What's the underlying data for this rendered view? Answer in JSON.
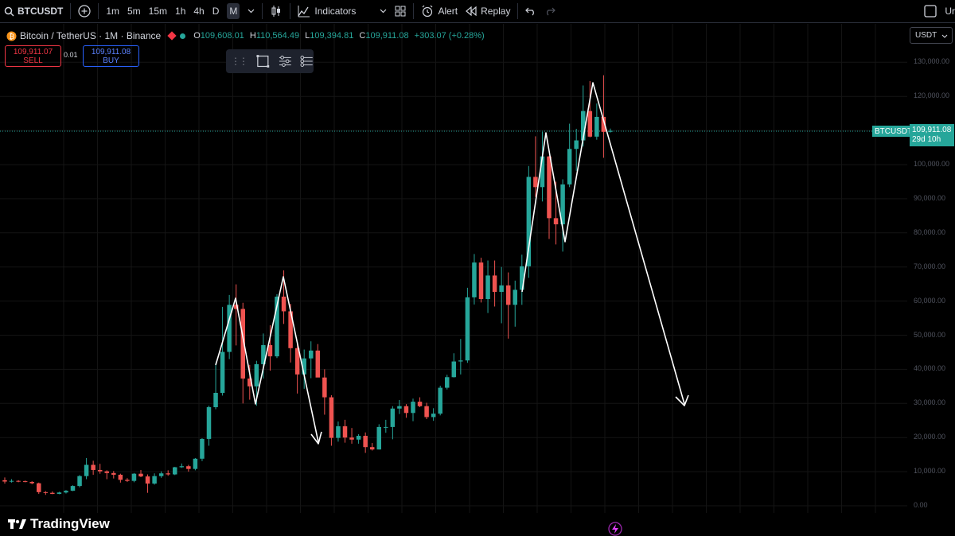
{
  "toolbar": {
    "symbol": "BTCUSDT",
    "intervals": [
      "1m",
      "5m",
      "15m",
      "1h",
      "4h",
      "D",
      "M"
    ],
    "selected_interval": "M",
    "indicators_label": "Indicators",
    "alert_label": "Alert",
    "replay_label": "Replay",
    "right_cut_label": "Ur"
  },
  "legend": {
    "title": "Bitcoin / TetherUS · 1M · Binance",
    "o_label": "O",
    "o": "109,608.01",
    "h_label": "H",
    "h": "110,564.49",
    "l_label": "L",
    "l": "109,394.81",
    "c_label": "C",
    "c": "109,911.08",
    "change": "+303.07 (+0.28%)"
  },
  "trade": {
    "sell_price": "109,911.07",
    "sell_label": "SELL",
    "spread": "0.01",
    "buy_price": "109,911.08",
    "buy_label": "BUY"
  },
  "currency": "USDT",
  "price_axis": {
    "labels": [
      "130,000.00",
      "120,000.00",
      "110,000.00",
      "100,000.00",
      "90,000.00",
      "80,000.00",
      "70,000.00",
      "60,000.00",
      "50,000.00",
      "40,000.00",
      "30,000.00",
      "20,000.00",
      "10,000.00",
      "0.00"
    ],
    "symbol_tag": "BTCUSDT",
    "last_price": "109,911.08",
    "countdown": "29d 10h"
  },
  "branding": {
    "name": "TradingView"
  },
  "colors": {
    "up": "#26a69a",
    "down": "#ef5350",
    "background": "#000000",
    "annotation": "#ffffff"
  },
  "chart_data": {
    "type": "candlestick",
    "interval": "1M",
    "ohlc": [
      [
        7500,
        8300,
        6500,
        7100
      ],
      [
        7100,
        7800,
        6800,
        7300
      ],
      [
        7300,
        7500,
        6900,
        7200
      ],
      [
        7200,
        7400,
        6900,
        7000
      ],
      [
        7000,
        7200,
        6300,
        6600
      ],
      [
        6600,
        6800,
        3500,
        4000
      ],
      [
        4000,
        4300,
        3200,
        3800
      ],
      [
        3800,
        4200,
        3400,
        3500
      ],
      [
        3500,
        4100,
        3400,
        3900
      ],
      [
        3900,
        4600,
        3600,
        4400
      ],
      [
        4400,
        6000,
        4300,
        5800
      ],
      [
        5800,
        9000,
        5400,
        8700
      ],
      [
        8700,
        14000,
        7800,
        12000
      ],
      [
        12000,
        13200,
        9100,
        10500
      ],
      [
        10500,
        12300,
        9400,
        10100
      ],
      [
        10100,
        10400,
        7800,
        9600
      ],
      [
        9600,
        10200,
        8000,
        9100
      ],
      [
        9100,
        9400,
        6800,
        7600
      ],
      [
        7600,
        8100,
        7000,
        7300
      ],
      [
        7300,
        9600,
        6900,
        9400
      ],
      [
        9400,
        10500,
        8400,
        8600
      ],
      [
        8600,
        9200,
        3800,
        6500
      ],
      [
        6500,
        9500,
        6200,
        8700
      ],
      [
        8700,
        10100,
        8200,
        9500
      ],
      [
        9500,
        10400,
        8800,
        9200
      ],
      [
        9200,
        11400,
        9000,
        11300
      ],
      [
        11300,
        12400,
        11100,
        11600
      ],
      [
        11600,
        12000,
        10000,
        10800
      ],
      [
        10800,
        14000,
        10400,
        13800
      ],
      [
        13800,
        19800,
        13100,
        19600
      ],
      [
        19600,
        29300,
        17600,
        28900
      ],
      [
        28900,
        41900,
        28300,
        33100
      ],
      [
        33100,
        58300,
        32300,
        45100
      ],
      [
        45100,
        61800,
        43000,
        58900
      ],
      [
        58900,
        64900,
        47000,
        57700
      ],
      [
        57700,
        59500,
        30000,
        37300
      ],
      [
        37300,
        41300,
        31100,
        35000
      ],
      [
        35000,
        42500,
        29300,
        41500
      ],
      [
        41500,
        50500,
        37300,
        47100
      ],
      [
        47100,
        52900,
        39600,
        43800
      ],
      [
        43800,
        62000,
        43300,
        61300
      ],
      [
        61300,
        69000,
        53300,
        57000
      ],
      [
        57000,
        59200,
        42000,
        46200
      ],
      [
        46200,
        48000,
        32900,
        38500
      ],
      [
        38500,
        45800,
        34300,
        43200
      ],
      [
        43200,
        48200,
        37400,
        45500
      ],
      [
        45500,
        47400,
        37700,
        37600
      ],
      [
        37600,
        40000,
        26700,
        31800
      ],
      [
        31800,
        32400,
        17600,
        19900
      ],
      [
        19900,
        24700,
        18800,
        23300
      ],
      [
        23300,
        25200,
        18500,
        20000
      ],
      [
        20000,
        22800,
        18200,
        19400
      ],
      [
        19400,
        21000,
        18200,
        20500
      ],
      [
        20500,
        21500,
        15500,
        17200
      ],
      [
        17200,
        18400,
        16200,
        16500
      ],
      [
        16500,
        23900,
        16500,
        23100
      ],
      [
        23100,
        25200,
        21400,
        23100
      ],
      [
        23100,
        29200,
        19500,
        28500
      ],
      [
        28500,
        31000,
        26900,
        29200
      ],
      [
        29200,
        29800,
        25800,
        27200
      ],
      [
        27200,
        31400,
        24800,
        30500
      ],
      [
        30500,
        31800,
        28900,
        29200
      ],
      [
        29200,
        30200,
        25400,
        26000
      ],
      [
        26000,
        28600,
        24900,
        27000
      ],
      [
        27000,
        35200,
        26500,
        34600
      ],
      [
        34600,
        38400,
        34100,
        37700
      ],
      [
        37700,
        44700,
        37600,
        42300
      ],
      [
        42300,
        48900,
        38500,
        42600
      ],
      [
        42600,
        63900,
        41900,
        61100
      ],
      [
        61100,
        73800,
        59000,
        71300
      ],
      [
        71300,
        72700,
        59600,
        60600
      ],
      [
        60600,
        71900,
        56500,
        67500
      ],
      [
        67500,
        71900,
        58400,
        62700
      ],
      [
        62700,
        70000,
        53500,
        64600
      ],
      [
        64600,
        68400,
        49000,
        58900
      ],
      [
        58900,
        66000,
        52500,
        63300
      ],
      [
        63300,
        73600,
        58900,
        70200
      ],
      [
        70200,
        99600,
        66800,
        96400
      ],
      [
        96400,
        108300,
        90500,
        93400
      ],
      [
        93400,
        109600,
        89200,
        102400
      ],
      [
        102400,
        102500,
        78200,
        84300
      ],
      [
        84300,
        95000,
        76600,
        82500
      ],
      [
        82500,
        95700,
        74500,
        94200
      ],
      [
        94200,
        112000,
        93400,
        104600
      ],
      [
        104600,
        110500,
        98200,
        107100
      ],
      [
        107100,
        123200,
        105300,
        115700
      ],
      [
        115700,
        124500,
        108000,
        108200
      ],
      [
        108200,
        117900,
        107300,
        114000
      ],
      [
        114000,
        126200,
        102000,
        109600
      ],
      [
        109608,
        110564,
        109395,
        109911
      ]
    ],
    "y_axis": {
      "min": 0,
      "max": 130000
    },
    "annotations": [
      {
        "type": "path",
        "points_note": "hand-drawn white zigzag with arrows indicating double-top patterns and projected decline"
      }
    ]
  }
}
